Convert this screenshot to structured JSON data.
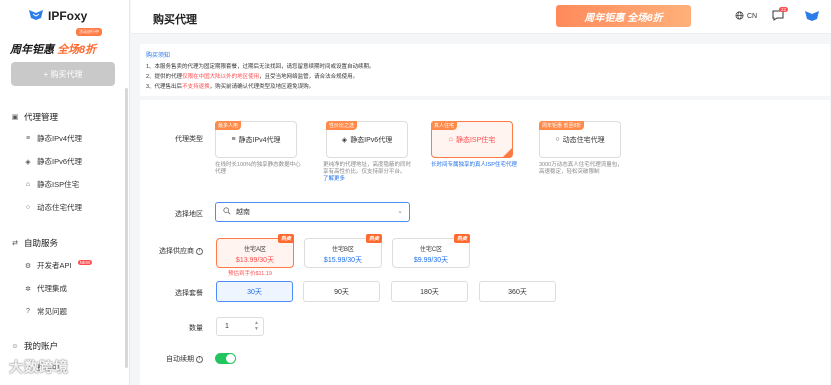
{
  "app": {
    "name": "IPFoxy"
  },
  "promo": {
    "badge": "活动进行中",
    "text_a": "周年钜惠",
    "text_b": "全场8折"
  },
  "sidebar": {
    "buy_button": "+ 购买代理",
    "section_proxy": "代理管理",
    "items_proxy": [
      "静态IPv4代理",
      "静态IPv6代理",
      "静态ISP住宅",
      "动态住宅代理"
    ],
    "section_service": "自助服务",
    "items_service": [
      "开发者API",
      "代理集成",
      "常见问题"
    ],
    "new_badge": "NEW",
    "section_account": "我的账户",
    "items_account": [
      "费用中心"
    ]
  },
  "header": {
    "title": "购买代理",
    "banner": "周年钜惠 全场8折",
    "lang": "CN",
    "msg_count": "22"
  },
  "notice": {
    "title": "购买须知",
    "line1": "1、本服务售卖的代理为固定期限套餐，过期后无法找回，请您留意续期时间或设置自动续期。",
    "line2_a": "2、提供的代理",
    "line2_red": "仅限在中国大陆以外的地区使用",
    "line2_b": "，且受当地网络监管，请合法合规使用。",
    "line3_a": "3、代理售出后",
    "line3_red": "不支持退换",
    "line3_b": "，购买前请确认代理类型及地区避免误购。"
  },
  "form": {
    "type_label": "代理类型",
    "region_label": "选择地区",
    "supplier_label": "选择供应商",
    "plan_label": "选择套餐",
    "qty_label": "数量",
    "renew_label": "自动续期"
  },
  "types": [
    {
      "tag": "最多人用",
      "name": "静态IPv4代理",
      "desc": "在线时长100%的独享静态数据中心代理"
    },
    {
      "tag": "性价比之选",
      "name": "静态IPv6代理",
      "desc": "更纯净的代理地址，高度隐蔽的同时享有高性价比。仅支持部分平台。",
      "link": "了解更多"
    },
    {
      "tag": "真人住宅",
      "name": "静态ISP住宅",
      "desc": "长时间专属独享的真人ISP住宅代理"
    },
    {
      "tag": "周年钜惠 低至8折",
      "name": "动态住宅代理",
      "desc": "3000万动态真人住宅代理流量包，高速稳定，轻松突破限制"
    }
  ],
  "region": {
    "value": "越南"
  },
  "suppliers": [
    {
      "name": "住宅A区",
      "price": "$13.99/30天",
      "hot": "热卖"
    },
    {
      "name": "住宅B区",
      "price": "$15.99/30天",
      "hot": "热卖"
    },
    {
      "name": "住宅C区",
      "price": "$9.99/30天",
      "hot": "热卖"
    }
  ],
  "discount_note": "预估到手价$11.19",
  "plans": [
    "30天",
    "90天",
    "180天",
    "360天"
  ],
  "quantity": "1",
  "watermark": "大数跨境"
}
